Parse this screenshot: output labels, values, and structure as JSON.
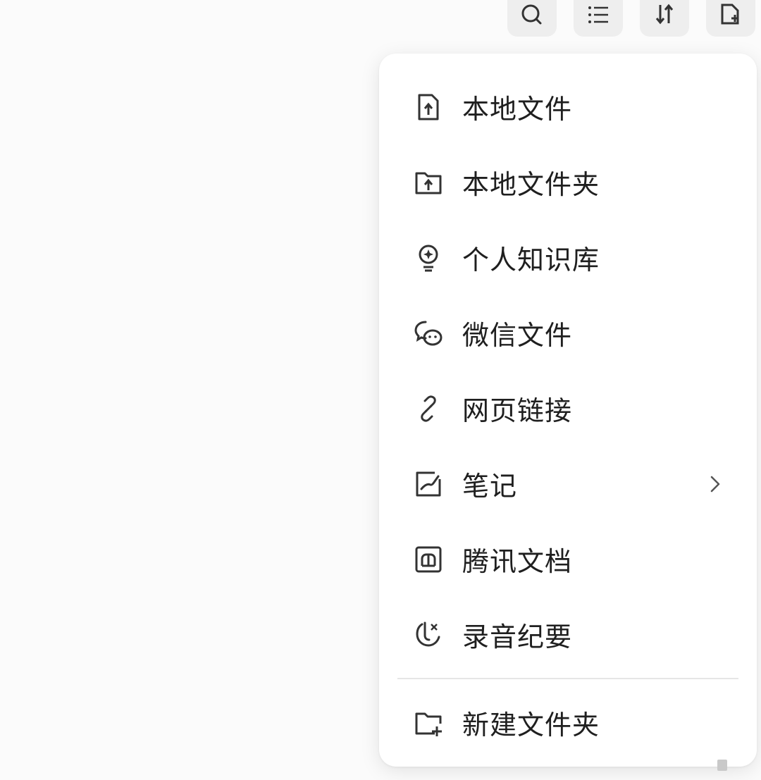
{
  "toolbar": {
    "buttons": [
      {
        "icon": "search-icon"
      },
      {
        "icon": "list-icon"
      },
      {
        "icon": "sort-icon"
      },
      {
        "icon": "new-file-icon"
      }
    ]
  },
  "menu": {
    "items": [
      {
        "label": "本地文件",
        "icon": "file-upload-icon"
      },
      {
        "label": "本地文件夹",
        "icon": "folder-upload-icon"
      },
      {
        "label": "个人知识库",
        "icon": "lightbulb-icon"
      },
      {
        "label": "微信文件",
        "icon": "wechat-icon"
      },
      {
        "label": "网页链接",
        "icon": "link-icon"
      },
      {
        "label": "笔记",
        "icon": "note-edit-icon",
        "has_submenu": true
      },
      {
        "label": "腾讯文档",
        "icon": "tencent-docs-icon"
      },
      {
        "label": "录音纪要",
        "icon": "recording-icon"
      }
    ],
    "footer_item": {
      "label": "新建文件夹",
      "icon": "new-folder-icon"
    }
  },
  "colors": {
    "text": "#1f1f1f",
    "icon": "#333333",
    "menu_bg": "#ffffff",
    "toolbar_btn_bg": "#eeeeee",
    "divider": "#e6e6e6"
  }
}
